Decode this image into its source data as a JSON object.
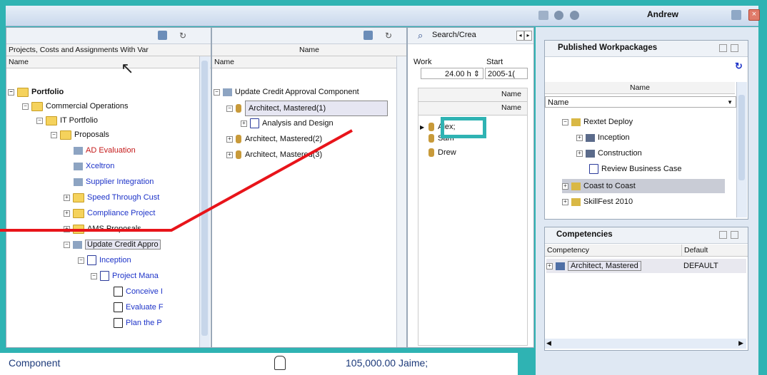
{
  "topbar": {
    "user": "Andrew"
  },
  "left_pane": {
    "view_title": "Projects, Costs and Assignments With Var",
    "column": "Name",
    "tree": [
      {
        "label": "Portfolio",
        "bold": true
      },
      {
        "label": "Commercial Operations"
      },
      {
        "label": "IT Portfolio"
      },
      {
        "label": "Proposals"
      },
      {
        "label": "AD Evaluation",
        "color": "red"
      },
      {
        "label": "Xceltron",
        "color": "blue"
      },
      {
        "label": "Supplier Integration",
        "color": "blue"
      },
      {
        "label": "Speed Through Cust",
        "color": "blue"
      },
      {
        "label": "Compliance Project",
        "color": "blue"
      },
      {
        "label": "AMS Proposals"
      },
      {
        "label": "Update Credit Appro"
      },
      {
        "label": "Inception",
        "color": "blue"
      },
      {
        "label": "Project Mana",
        "color": "blue"
      },
      {
        "label": "Conceive I",
        "color": "blue"
      },
      {
        "label": "Evaluate F",
        "color": "blue"
      },
      {
        "label": "Plan the P",
        "color": "blue"
      }
    ]
  },
  "middle_pane": {
    "column_header": "Name",
    "name_label": "Name",
    "tree": [
      {
        "label": "Update Credit Approval Component"
      },
      {
        "label": "Architect, Mastered(1)"
      },
      {
        "label": "Analysis and Design"
      },
      {
        "label": "Architect, Mastered(2)"
      },
      {
        "label": "Architect, Mastered(3)"
      }
    ]
  },
  "search_pane": {
    "tab": "Search/Crea",
    "work_label": "Work",
    "start_label": "Start",
    "work_value": "24.00 h",
    "start_value": "2005-1(",
    "name1": "Name",
    "name2": "Name",
    "people": [
      "Alex;",
      "Sam",
      "Drew"
    ]
  },
  "published": {
    "title": "Published Workpackages",
    "column": "Name",
    "name_label": "Name",
    "items": [
      {
        "label": "Rextet Deploy"
      },
      {
        "label": "Inception"
      },
      {
        "label": "Construction"
      },
      {
        "label": "Review Business Case"
      },
      {
        "label": "Coast to Coast"
      },
      {
        "label": "SkillFest 2010"
      }
    ]
  },
  "competencies": {
    "title": "Competencies",
    "col_competency": "Competency",
    "col_default": "Default",
    "row_name": "Architect, Mastered",
    "row_default": "DEFAULT"
  },
  "statusbar": {
    "component": "Component",
    "amount": "105,000.00 Jaime;"
  },
  "colors": {
    "accent": "#2fb3b3",
    "annotation": "#e8141a",
    "link": "#1d33c8"
  }
}
